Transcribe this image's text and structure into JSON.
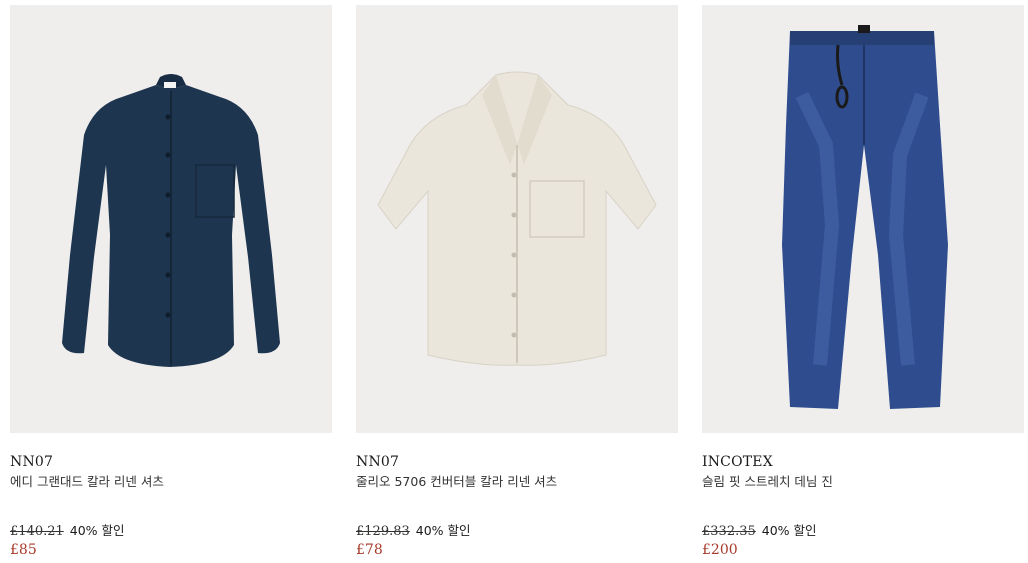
{
  "products": [
    {
      "brand": "NN07",
      "name": "에디 그랜대드 칼라 리넨 셔츠",
      "original_price": "£140.21",
      "discount": "40% 할인",
      "sale_price": "£85",
      "image_icon": "navy-linen-shirt-image"
    },
    {
      "brand": "NN07",
      "name": "줄리오 5706 컨버터블 칼라 리넨 셔츠",
      "original_price": "£129.83",
      "discount": "40% 할인",
      "sale_price": "£78",
      "image_icon": "cream-camp-collar-shirt-image"
    },
    {
      "brand": "INCOTEX",
      "name": "슬림 핏 스트레치 데님 진",
      "original_price": "£332.35",
      "discount": "40% 할인",
      "sale_price": "£200",
      "image_icon": "blue-denim-jeans-image"
    }
  ],
  "colors": {
    "sale": "#a73a2a",
    "image_bg": "#efeeec",
    "navy_shirt": "#1e3550",
    "cream_shirt": "#ebe6dc",
    "denim": "#2f4d8e"
  }
}
